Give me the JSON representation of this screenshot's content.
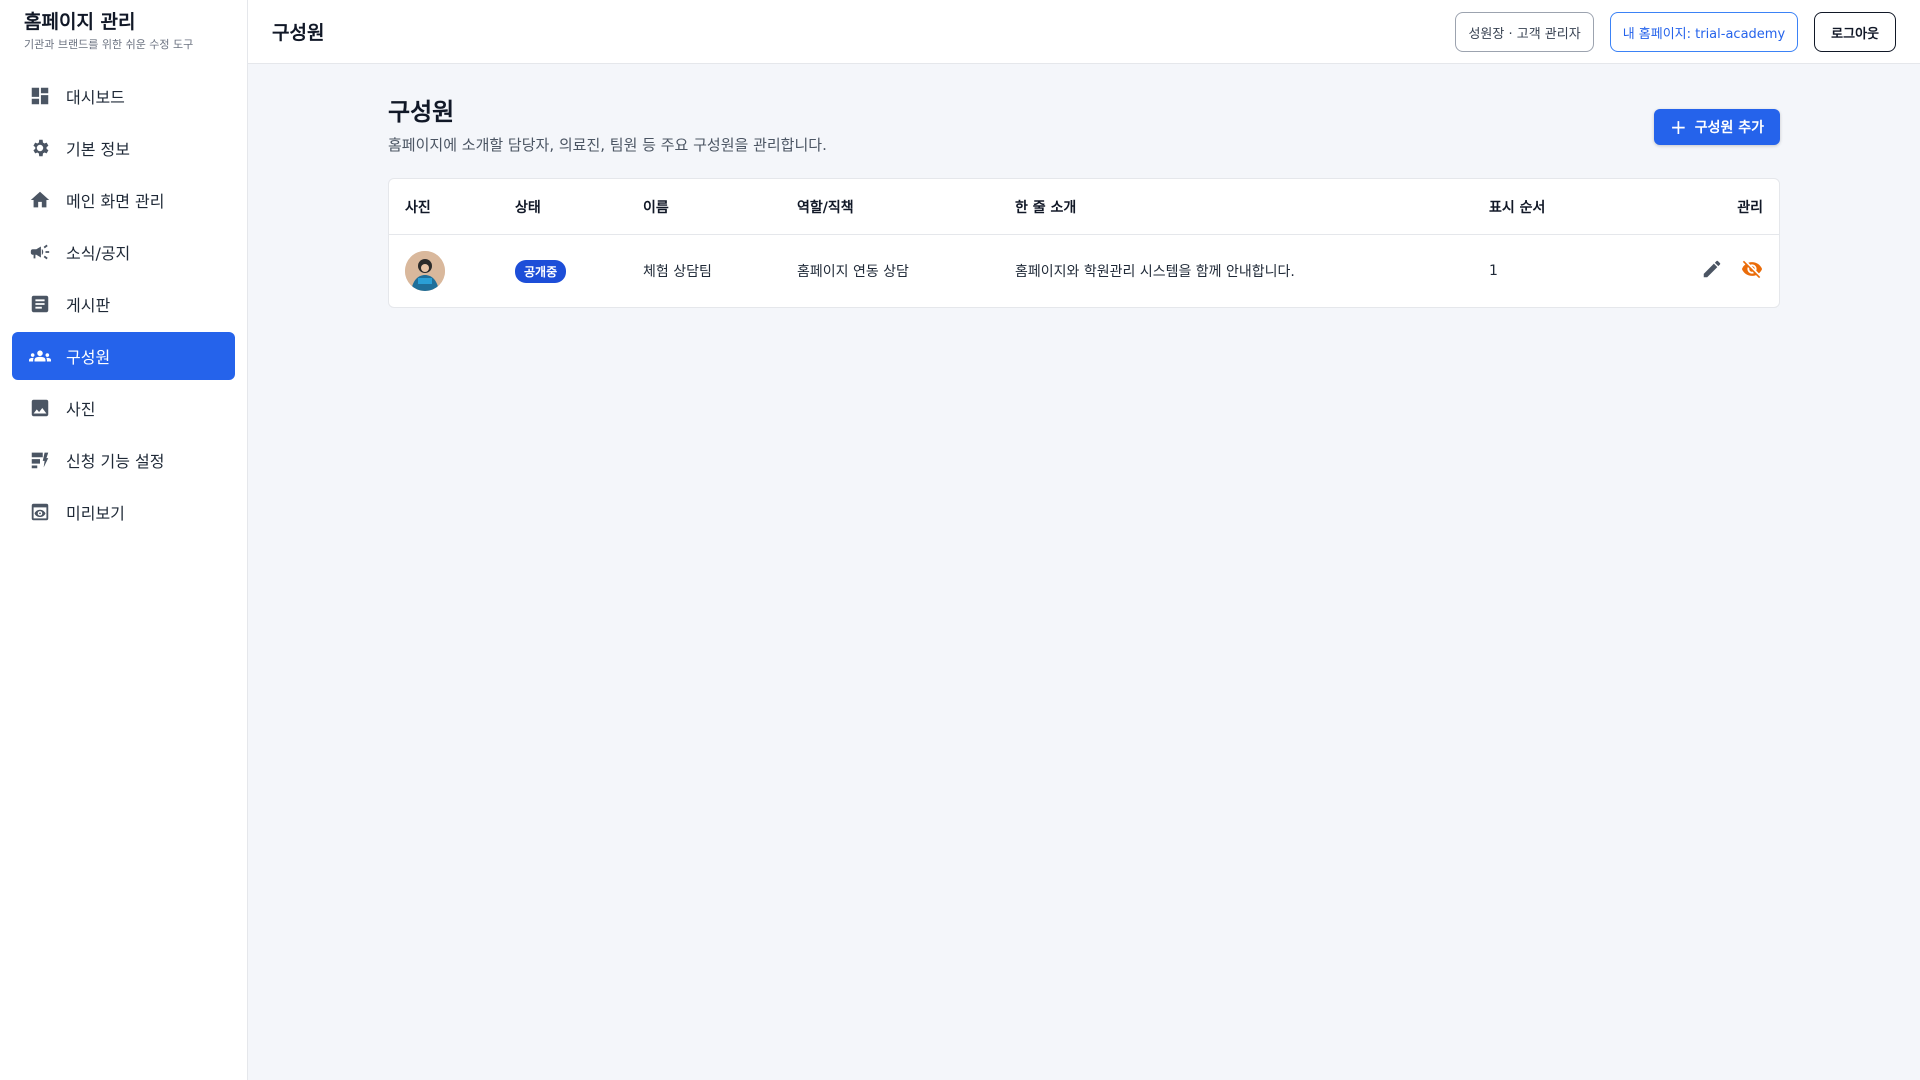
{
  "sidebar": {
    "title": "홈페이지 관리",
    "subtitle": "기관과 브랜드를 위한 쉬운 수정 도구",
    "items": [
      {
        "label": "대시보드",
        "icon": "dashboard-icon"
      },
      {
        "label": "기본 정보",
        "icon": "gear-icon"
      },
      {
        "label": "메인 화면 관리",
        "icon": "home-icon"
      },
      {
        "label": "소식/공지",
        "icon": "megaphone-icon"
      },
      {
        "label": "게시판",
        "icon": "article-icon"
      },
      {
        "label": "구성원",
        "icon": "people-icon",
        "active": true
      },
      {
        "label": "사진",
        "icon": "image-icon"
      },
      {
        "label": "신청 기능 설정",
        "icon": "form-settings-icon"
      },
      {
        "label": "미리보기",
        "icon": "preview-icon"
      }
    ]
  },
  "header": {
    "title": "구성원",
    "role_label": "성원장 · 고객 관리자",
    "homepage_link": "내 홈페이지: trial-academy",
    "logout": "로그아웃"
  },
  "main": {
    "title": "구성원",
    "description": "홈페이지에 소개할 담당자, 의료진, 팀원 등 주요 구성원을 관리합니다.",
    "add_button": "구성원 추가",
    "table": {
      "columns": [
        "사진",
        "상태",
        "이름",
        "역할/직책",
        "한 줄 소개",
        "표시 순서",
        "관리"
      ],
      "rows": [
        {
          "status": "공개중",
          "name": "체험 상담팀",
          "role": "홈페이지 연동 상담",
          "intro": "홈페이지와 학원관리 시스템을 함께 안내합니다.",
          "order": "1"
        }
      ]
    }
  },
  "colors": {
    "accent": "#2563eb",
    "hide_icon": "#ea6c0a"
  }
}
